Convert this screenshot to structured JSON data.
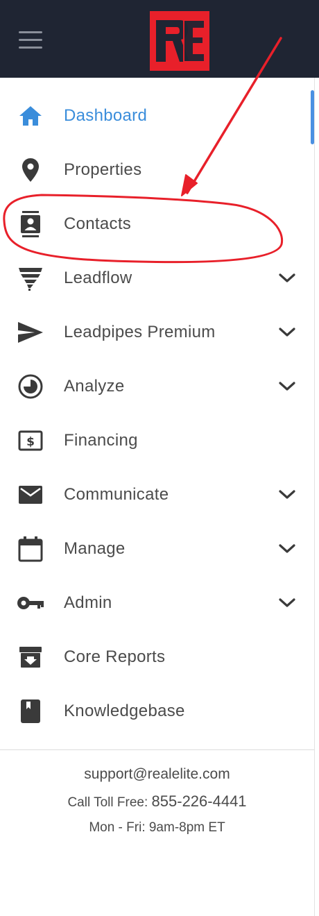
{
  "header": {
    "menu_icon": "hamburger-icon",
    "logo_text": "RE",
    "logo_colors": {
      "red": "#e8202a",
      "dark": "#1f2533"
    }
  },
  "sidebar": {
    "active_color": "#3a8ddb",
    "items": [
      {
        "label": "Dashboard",
        "icon": "home-icon",
        "active": true,
        "expandable": false
      },
      {
        "label": "Properties",
        "icon": "map-pin-icon",
        "active": false,
        "expandable": false
      },
      {
        "label": "Contacts",
        "icon": "contacts-icon",
        "active": false,
        "expandable": false
      },
      {
        "label": "Leadflow",
        "icon": "tornado-icon",
        "active": false,
        "expandable": true
      },
      {
        "label": "Leadpipes Premium",
        "icon": "send-icon",
        "active": false,
        "expandable": true
      },
      {
        "label": "Analyze",
        "icon": "pie-chart-icon",
        "active": false,
        "expandable": true
      },
      {
        "label": "Financing",
        "icon": "dollar-bill-icon",
        "active": false,
        "expandable": false
      },
      {
        "label": "Communicate",
        "icon": "envelope-icon",
        "active": false,
        "expandable": true
      },
      {
        "label": "Manage",
        "icon": "calendar-icon",
        "active": false,
        "expandable": true
      },
      {
        "label": "Admin",
        "icon": "key-icon",
        "active": false,
        "expandable": true
      },
      {
        "label": "Core Reports",
        "icon": "archive-icon",
        "active": false,
        "expandable": false
      },
      {
        "label": "Knowledgebase",
        "icon": "book-icon",
        "active": false,
        "expandable": false
      }
    ]
  },
  "footer": {
    "email": "support@realelite.com",
    "phone_label": "Call Toll Free:",
    "phone_number": "855-226-4441",
    "hours": "Mon - Fri: 9am-8pm ET"
  },
  "annotation": {
    "color": "#e8202a",
    "highlighted_item": "Contacts"
  }
}
